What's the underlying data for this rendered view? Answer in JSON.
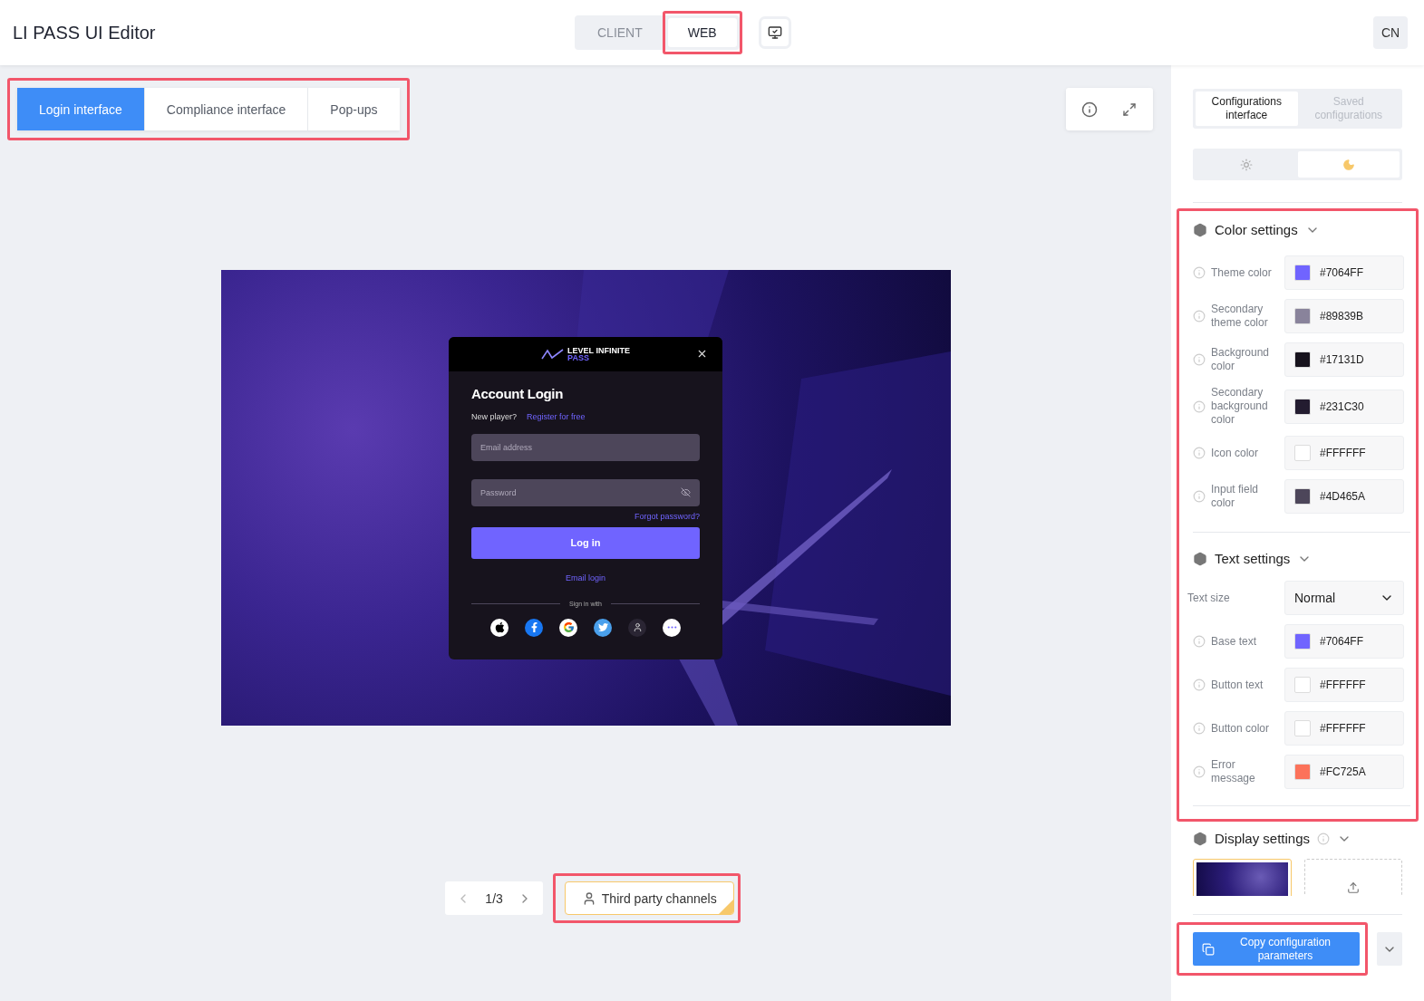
{
  "header": {
    "title": "LI PASS UI Editor",
    "platform_tabs": [
      {
        "label": "CLIENT",
        "selected": false
      },
      {
        "label": "WEB",
        "selected": true
      }
    ],
    "language_button": "CN"
  },
  "preview_tabs": [
    {
      "label": "Login interface",
      "selected": true
    },
    {
      "label": "Compliance interface",
      "selected": false
    },
    {
      "label": "Pop-ups",
      "selected": false
    }
  ],
  "login_dialog": {
    "logo_text": "LEVEL INFINITE",
    "logo_subtext": "PASS",
    "title": "Account Login",
    "new_player": "New player?",
    "register_link": "Register for free",
    "email_placeholder": "Email address",
    "password_placeholder": "Password",
    "forgot_link": "Forgot password?",
    "login_button": "Log in",
    "email_login_link": "Email login",
    "sign_in_with": "Sign in with"
  },
  "pager": {
    "page": "1/3"
  },
  "third_party": {
    "label": "Third party channels",
    "checked": true
  },
  "sidebar": {
    "tabs": [
      {
        "label": "Configurations interface",
        "selected": true
      },
      {
        "label": "Saved configurations",
        "selected": false
      }
    ],
    "theme_modes": [
      {
        "kind": "light",
        "selected": false
      },
      {
        "kind": "dark",
        "selected": true
      }
    ],
    "color_settings": {
      "title": "Color settings",
      "rows": [
        {
          "label": "Theme color",
          "value": "#7064FF",
          "color": "#7064ff"
        },
        {
          "label": "Secondary theme color",
          "value": "#89839B",
          "color": "#89839b"
        },
        {
          "label": "Background color",
          "value": "#17131D",
          "color": "#17131d"
        },
        {
          "label": "Secondary background color",
          "value": "#231C30",
          "color": "#231c30"
        },
        {
          "label": "Icon color",
          "value": "#FFFFFF",
          "color": "#ffffff"
        },
        {
          "label": "Input field color",
          "value": "#4D465A",
          "color": "#4d465a"
        }
      ]
    },
    "text_settings": {
      "title": "Text settings",
      "size_label": "Text size",
      "size_value": "Normal",
      "rows": [
        {
          "label": "Base text",
          "value": "#7064FF",
          "color": "#7064ff"
        },
        {
          "label": "Button text",
          "value": "#FFFFFF",
          "color": "#ffffff"
        },
        {
          "label": "Button color",
          "value": "#FFFFFF",
          "color": "#ffffff"
        },
        {
          "label": "Error message",
          "value": "#FC725A",
          "color": "#fc725a"
        }
      ]
    },
    "display_settings": {
      "title": "Display settings"
    },
    "copy_button": "Copy configuration parameters"
  }
}
